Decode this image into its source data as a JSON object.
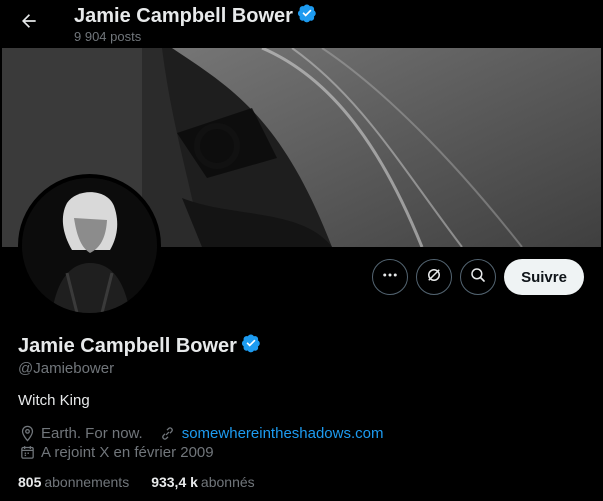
{
  "header": {
    "title": "Jamie Campbell Bower",
    "post_count": "9 904 posts"
  },
  "colors": {
    "verified": "#1d9bf0",
    "link": "#1d9bf0",
    "muted": "#71767b"
  },
  "actions": {
    "more_icon": "more-icon",
    "grok_icon": "grok-icon",
    "search_icon": "search-icon",
    "follow_label": "Suivre"
  },
  "profile": {
    "name": "Jamie Campbell Bower",
    "handle": "@Jamiebower",
    "bio": "Witch King",
    "location": "Earth. For now.",
    "website": "somewhereintheshadows.com",
    "joined": "A rejoint X en février 2009"
  },
  "stats": {
    "following_count": "805",
    "following_label": "abonnements",
    "followers_count": "933,4 k",
    "followers_label": "abonnés"
  }
}
